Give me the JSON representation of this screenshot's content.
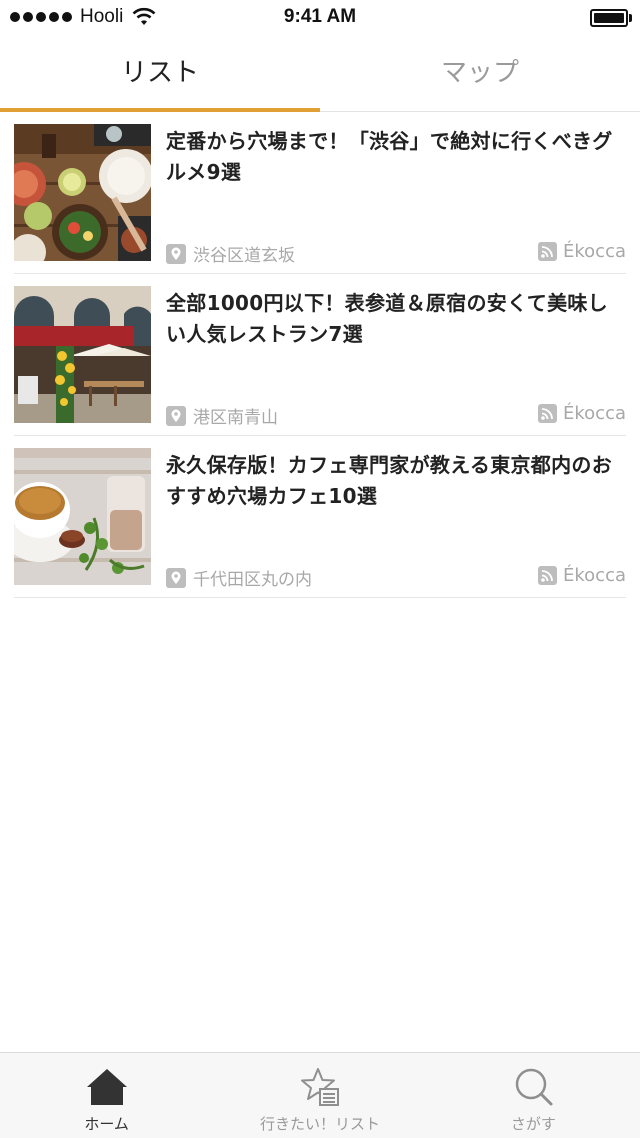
{
  "status_bar": {
    "carrier": "Hooli",
    "time": "9:41 AM"
  },
  "tabs": {
    "list_label": "リスト",
    "map_label": "マップ",
    "accent_color": "#e0a034"
  },
  "articles": [
    {
      "title": "定番から穴場まで！「渋谷」で絶対に行くべきグルメ9選",
      "location": "渋谷区道玄坂",
      "source": "Ékocca",
      "image": "food-table-photo"
    },
    {
      "title": "全部1000円以下！表参道＆原宿の安くて美味しい人気レストラン7選",
      "location": "港区南青山",
      "source": "Ékocca",
      "image": "restaurant-terrace-photo"
    },
    {
      "title": "永久保存版！カフェ専門家が教える東京都内のおすすめ穴場カフェ10選",
      "location": "千代田区丸の内",
      "source": "Ékocca",
      "image": "coffee-milk-photo"
    }
  ],
  "tab_bar": {
    "home_label": "ホーム",
    "wishlist_label": "行きたい！リスト",
    "search_label": "さがす"
  }
}
